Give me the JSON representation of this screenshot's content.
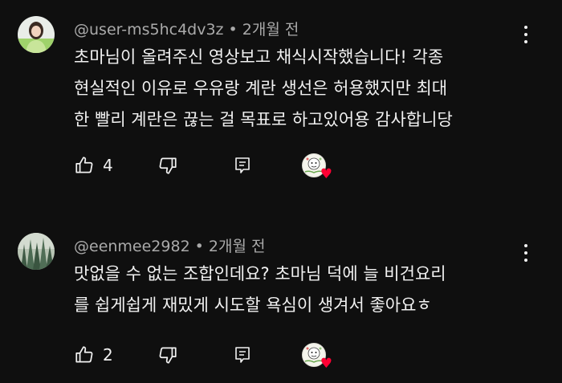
{
  "comments": [
    {
      "author": "@user-ms5hc4dv3z",
      "separator": "•",
      "time": "2개월 전",
      "lines": [
        "초마님이 올려주신 영상보고 채식시작했습니다! 각종",
        "현실적인 이유로 우유랑 계란 생선은 허용했지만 최대",
        "한 빨리 계란은 끊는 걸 목표로 하고있어용 감사합니당"
      ],
      "like_count": "4",
      "icons": {
        "like": "thumbs-up-icon",
        "dislike": "thumbs-down-icon",
        "reply": "reply-icon",
        "heart": "heart-icon"
      }
    },
    {
      "author": "@eenmee2982",
      "separator": "•",
      "time": "2개월 전",
      "lines": [
        "맛없을 수 없는 조합인데요? 초마님 덕에 늘 비건요리",
        "를 쉽게쉽게 재밌게 시도할 욕심이 생겨서 좋아요ㅎ"
      ],
      "like_count": "2",
      "icons": {
        "like": "thumbs-up-icon",
        "dislike": "thumbs-down-icon",
        "reply": "reply-icon",
        "heart": "heart-icon"
      }
    }
  ],
  "colors": {
    "background": "#0f0f0f",
    "text": "#f1f1f1",
    "meta": "#aaaaaa",
    "heart": "#ff0033"
  }
}
